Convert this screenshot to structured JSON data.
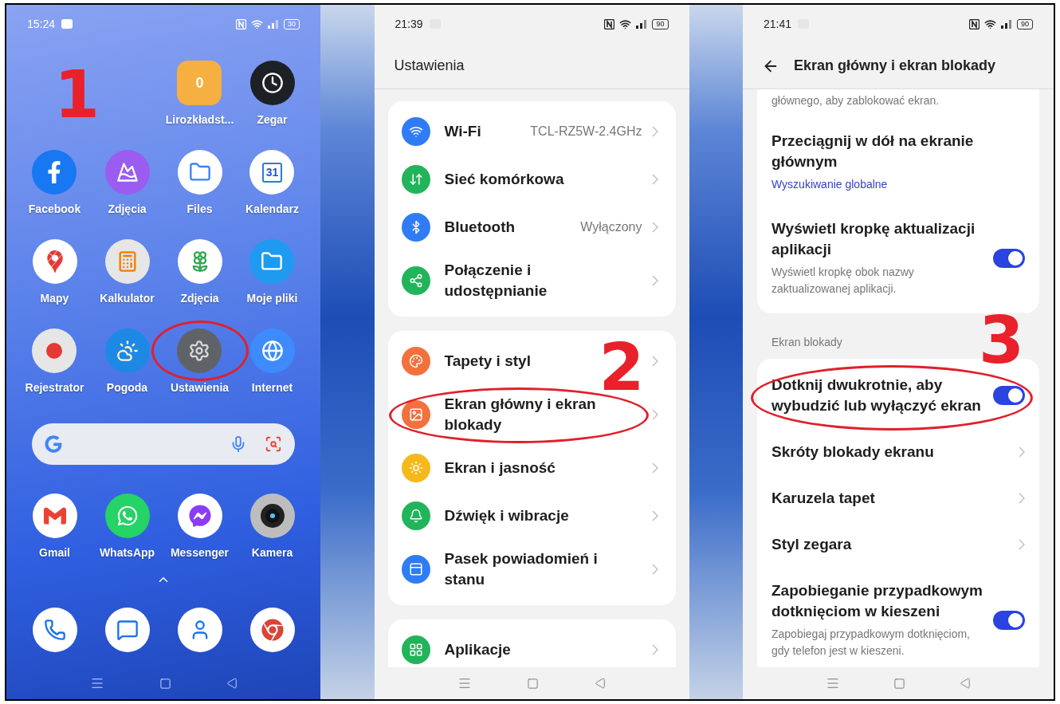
{
  "home_screen": {
    "status_bar": {
      "time": "15:24",
      "battery": "30"
    },
    "apps": [
      {
        "label": "Lirozkładst...",
        "icon_text": "0",
        "circled": false
      },
      {
        "label": "Zegar",
        "circled": false
      },
      {
        "label": "Facebook",
        "circled": false
      },
      {
        "label": "Zdjęcia",
        "circled": false
      },
      {
        "label": "Files",
        "circled": false
      },
      {
        "label": "Kalendarz",
        "icon_text": "31",
        "circled": false
      },
      {
        "label": "Mapy",
        "circled": false
      },
      {
        "label": "Kalkulator",
        "circled": false
      },
      {
        "label": "Zdjęcia",
        "circled": false
      },
      {
        "label": "Moje pliki",
        "circled": false
      },
      {
        "label": "Rejestrator",
        "circled": false
      },
      {
        "label": "Pogoda",
        "circled": false
      },
      {
        "label": "Ustawienia",
        "circled": true
      },
      {
        "label": "Internet",
        "circled": false
      },
      {
        "label": "Gmail",
        "circled": false
      },
      {
        "label": "WhatsApp",
        "circled": false
      },
      {
        "label": "Messenger",
        "circled": false
      },
      {
        "label": "Kamera",
        "circled": false
      }
    ],
    "step": "1"
  },
  "settings_screen": {
    "status_bar": {
      "time": "21:39",
      "battery": "90"
    },
    "title": "Ustawienia",
    "groups": [
      {
        "items": [
          {
            "title": "Wi-Fi",
            "value": "TCL-RZ5W-2.4GHz",
            "color": "#2f7cf6",
            "circled": false
          },
          {
            "title": "Sieć komórkowa",
            "color": "#22b45a",
            "circled": false
          },
          {
            "title": "Bluetooth",
            "value": "Wyłączony",
            "color": "#2f7cf6",
            "circled": false
          },
          {
            "title": "Połączenie i udostępnianie",
            "color": "#22b45a",
            "circled": false
          }
        ]
      },
      {
        "items": [
          {
            "title": "Tapety i styl",
            "color": "#f4703c",
            "circled": false
          },
          {
            "title": "Ekran główny i ekran blokady",
            "color": "#f4703c",
            "circled": true
          },
          {
            "title": "Ekran i jasność",
            "color": "#f6b91c",
            "circled": false
          },
          {
            "title": "Dźwięk i wibracje",
            "color": "#22b45a",
            "circled": false
          },
          {
            "title": "Pasek powiadomień i stanu",
            "color": "#2f7cf6",
            "circled": false
          }
        ]
      },
      {
        "items": [
          {
            "title": "Aplikacje",
            "color": "#22b45a",
            "circled": false
          }
        ]
      }
    ],
    "step": "2"
  },
  "lock_settings_screen": {
    "status_bar": {
      "time": "21:41",
      "battery": "90"
    },
    "title": "Ekran główny i ekran blokady",
    "cards": [
      {
        "items": [
          {
            "kind": "fragment",
            "description": "głównego, aby zablokować ekran.",
            "circled": false
          },
          {
            "kind": "value",
            "title": "Przeciągnij w dół na ekranie głównym",
            "value": "Wyszukiwanie globalne",
            "circled": false
          },
          {
            "kind": "toggle",
            "title": "Wyświetl kropkę aktualizacji aplikacji",
            "description": "Wyświetl kropkę obok nazwy zaktualizowanej aplikacji.",
            "on": true,
            "circled": false
          }
        ]
      },
      {
        "section": "Ekran blokady",
        "items": [
          {
            "kind": "toggle",
            "title": "Dotknij dwukrotnie, aby wybudzić lub wyłączyć ekran",
            "on": true,
            "circled": true
          },
          {
            "kind": "link",
            "title": "Skróty blokady ekranu",
            "circled": false
          },
          {
            "kind": "link",
            "title": "Karuzela tapet",
            "circled": false
          },
          {
            "kind": "link",
            "title": "Styl zegara",
            "circled": false
          },
          {
            "kind": "toggle",
            "title": "Zapobieganie przypadkowym dotknięciom w kieszeni",
            "description": "Zapobiegaj przypadkowym dotknięciom, gdy telefon jest w kieszeni.",
            "on": true,
            "circled": false
          }
        ]
      }
    ],
    "step": "3"
  }
}
